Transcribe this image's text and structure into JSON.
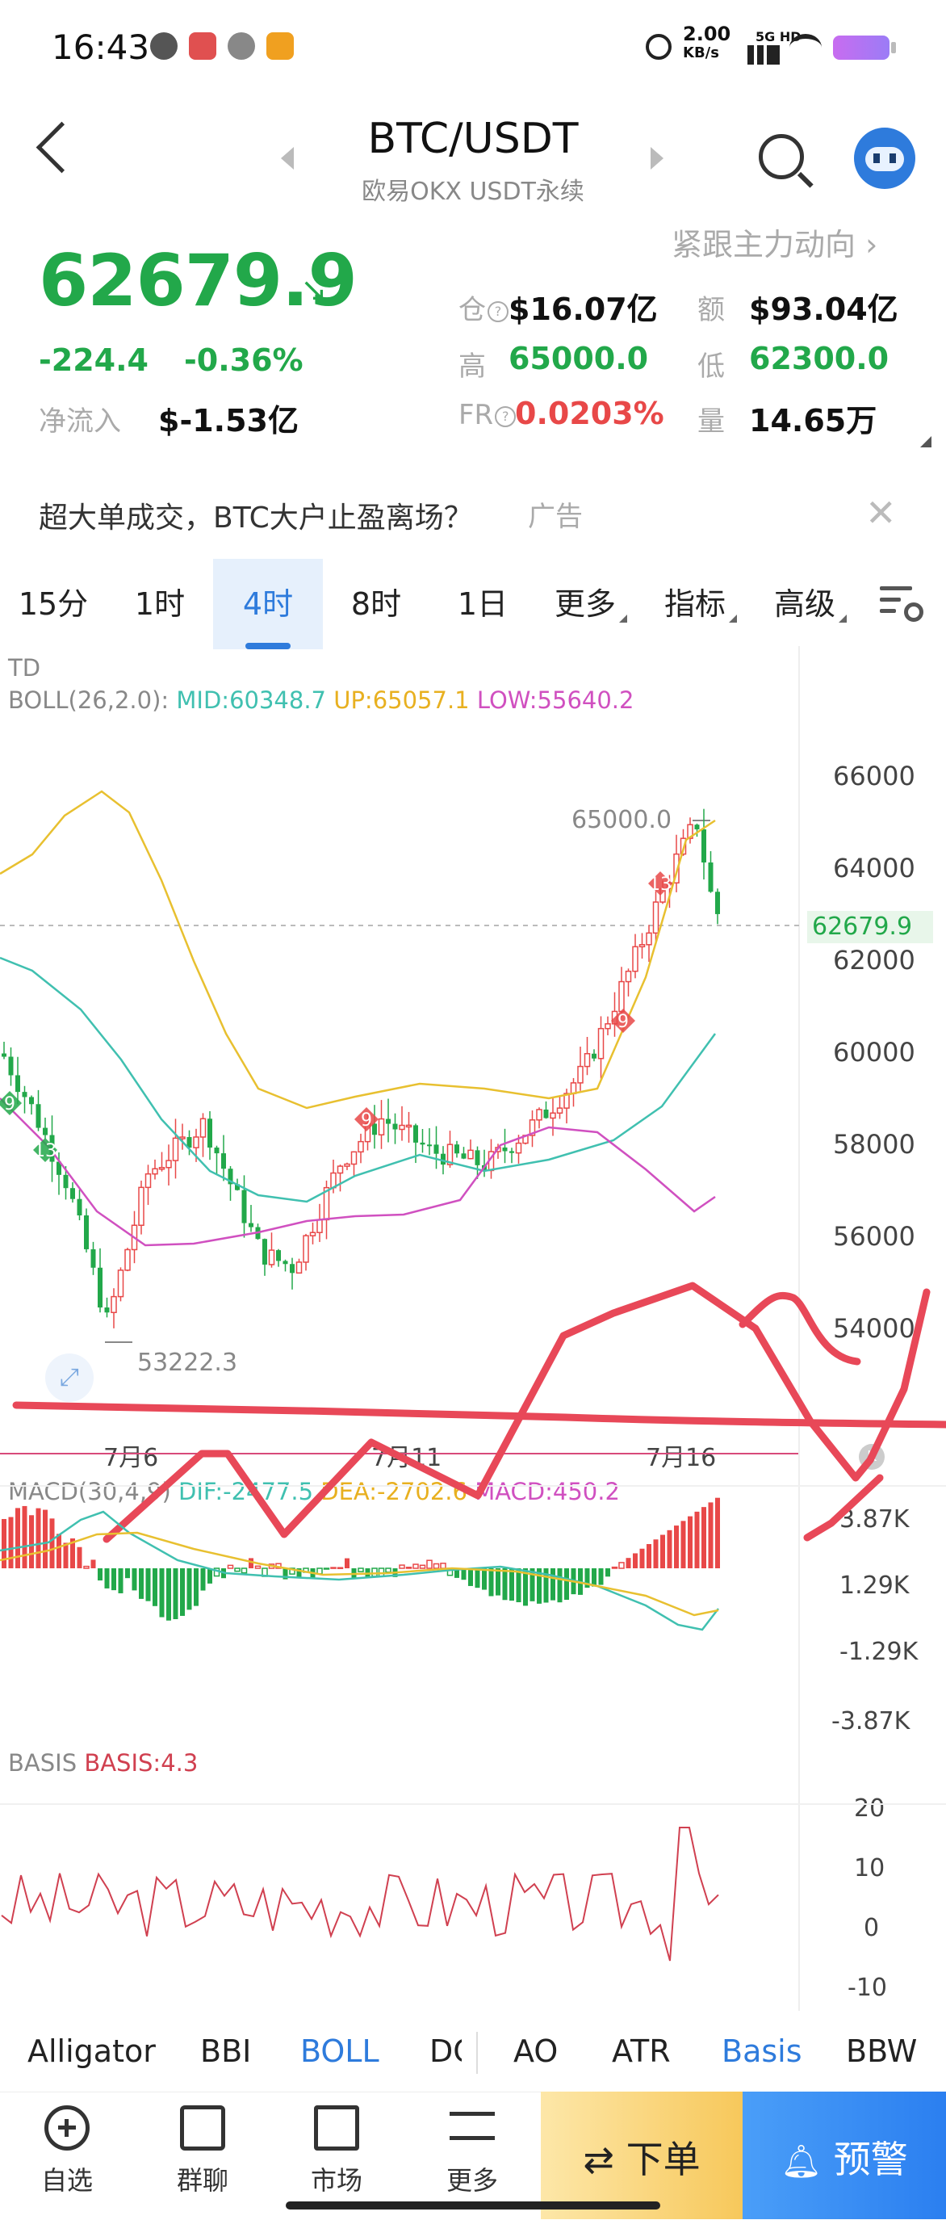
{
  "status_bar": {
    "time": "16:43",
    "net_speed_top": "2.00",
    "net_speed_unit": "KB/s",
    "signal": "5G HD"
  },
  "header": {
    "pair": "BTC/USDT",
    "exchange": "欧易OKX USDT永续",
    "follow_link": "紧跟主力动向 ›"
  },
  "ticker": {
    "price": "62679.9",
    "change": "-224.4",
    "change_pct": "-0.36%",
    "net_inflow_label": "净流入",
    "net_inflow": "$-1.53亿",
    "oi_label": "仓",
    "oi": "$16.07亿",
    "amount_label": "额",
    "amount": "$93.04亿",
    "high_label": "高",
    "high": "65000.0",
    "low_label": "低",
    "low": "62300.0",
    "fr_label": "FR",
    "fr": "0.0203%",
    "volume_label": "量",
    "volume": "14.65万"
  },
  "ad": {
    "text": "超大单成交，BTC大户止盈离场？",
    "tag": "广告"
  },
  "timeframes": [
    {
      "label": "15分",
      "active": false
    },
    {
      "label": "1时",
      "active": false
    },
    {
      "label": "4时",
      "active": true
    },
    {
      "label": "8时",
      "active": false
    },
    {
      "label": "1日",
      "active": false
    },
    {
      "label": "更多",
      "active": false
    },
    {
      "label": "指标",
      "active": false
    },
    {
      "label": "高级",
      "active": false
    }
  ],
  "main_chart": {
    "td_label": "TD",
    "boll": {
      "name": "BOLL(26,2.0):",
      "mid": "MID:60348.7",
      "up": "UP:65057.1",
      "low": "LOW:55640.2"
    },
    "y_ticks": [
      "66000",
      "64000",
      "62000",
      "60000",
      "58000",
      "56000",
      "54000"
    ],
    "x_ticks": [
      "7月6",
      "7月11",
      "7月16"
    ],
    "high_mark": "65000.0",
    "low_mark": "53222.3",
    "last_price_tag": "62679.9",
    "td_marks": [
      "9",
      "13",
      "9",
      "13",
      "9"
    ]
  },
  "macd": {
    "name": "MACD(30,4,9)",
    "dif": "DIF:-2477.5",
    "dea": "DEA:-2702.6",
    "macd": "MACD:450.2",
    "y_ticks": [
      "3.87K",
      "1.29K",
      "-1.29K",
      "-3.87K"
    ]
  },
  "basis": {
    "name": "BASIS",
    "value": "BASIS:4.3",
    "y_ticks": [
      "20",
      "10",
      "0",
      "-10"
    ]
  },
  "indicator_tabs": [
    {
      "label": "Alligator",
      "active": false
    },
    {
      "label": "BBI",
      "active": false
    },
    {
      "label": "BOLL",
      "active": true
    },
    {
      "label": "DC",
      "active": false
    },
    {
      "label": "AO",
      "active": false
    },
    {
      "label": "ATR",
      "active": false
    },
    {
      "label": "Basis",
      "active": true
    },
    {
      "label": "BBW",
      "active": false
    }
  ],
  "nav": {
    "watchlist": "自选",
    "chat": "群聊",
    "market": "市场",
    "more": "更多",
    "order": "⇄ 下单",
    "alert": "预警"
  },
  "colors": {
    "up": "#e84848",
    "down": "#22a84a",
    "accent": "#2e7bdc",
    "boll_mid": "#40c0b0",
    "boll_up": "#e8c030",
    "boll_low": "#d050c0"
  }
}
